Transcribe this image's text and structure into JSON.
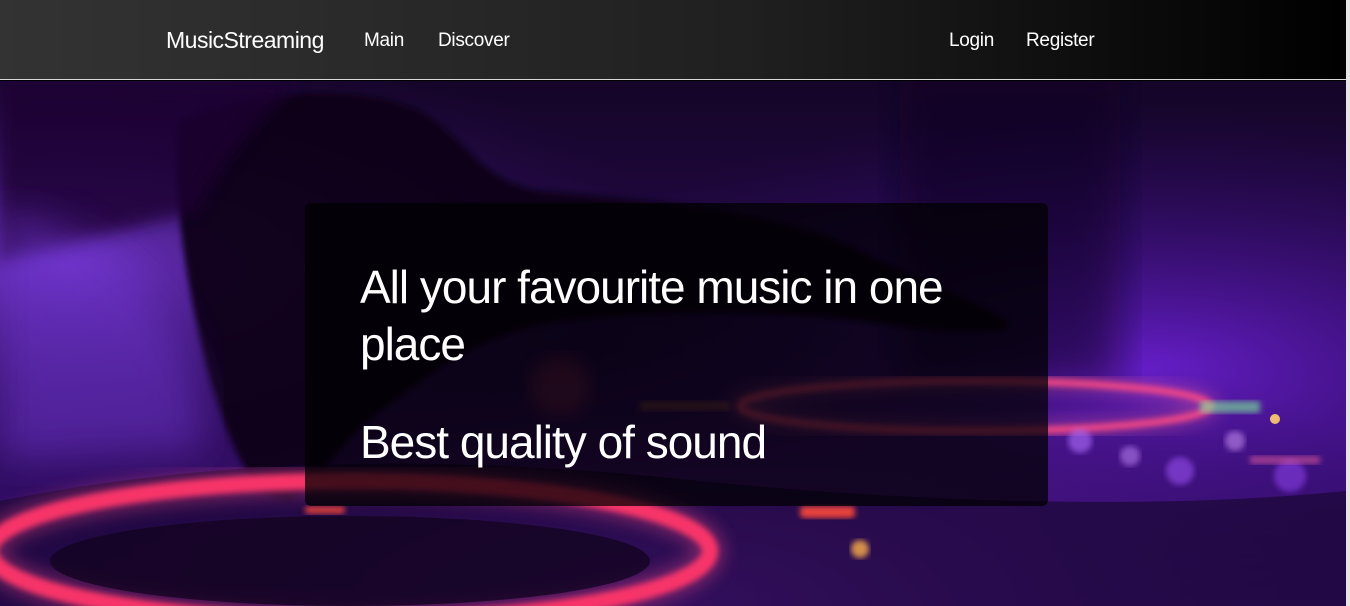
{
  "navbar": {
    "brand": "MusicStreaming",
    "links_left": [
      "Main",
      "Discover"
    ],
    "links_right": [
      "Login",
      "Register"
    ]
  },
  "hero": {
    "title": "All your favourite music in one place",
    "subtitle": "Best quality of sound"
  },
  "colors": {
    "navbar_left": "#333333",
    "navbar_right": "#000000",
    "hero_purple": "#5a1aa8",
    "neon_red": "#ff2a5a",
    "card_overlay": "#000000"
  }
}
